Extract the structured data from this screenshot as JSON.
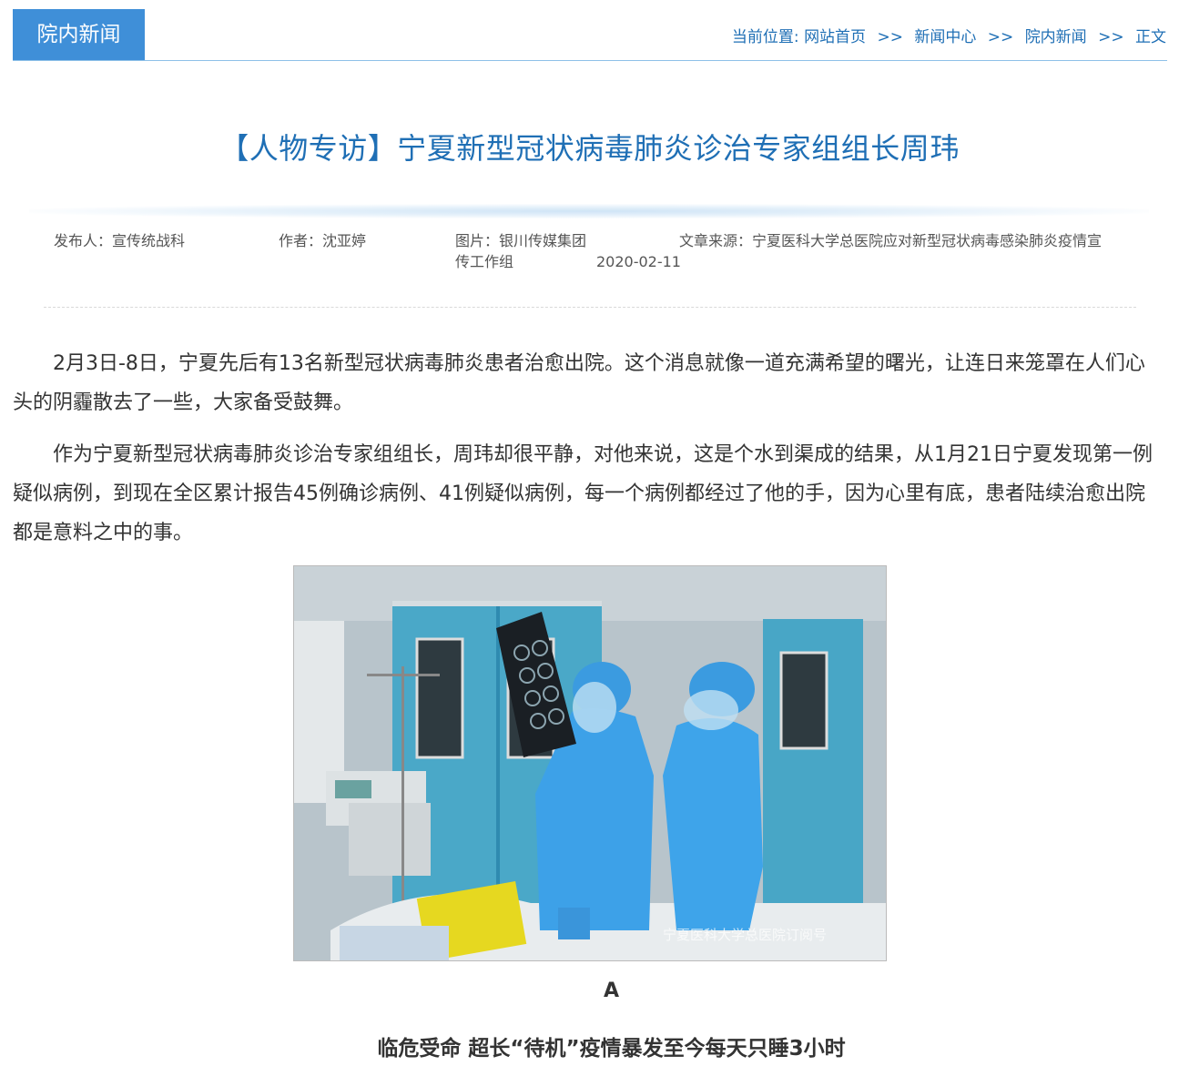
{
  "section_tab": "院内新闻",
  "breadcrumb": {
    "prefix": "当前位置:",
    "items": [
      "网站首页",
      "新闻中心",
      "院内新闻",
      "正文"
    ],
    "separator": ">>"
  },
  "article": {
    "title": "【人物专访】宁夏新型冠状病毒肺炎诊治专家组组长周玮",
    "meta": {
      "publisher": "发布人：宣传统战科",
      "author": "作者：沈亚婷",
      "photo_credit_line1": "图片：银川传媒集团",
      "photo_credit_line2": "传工作组",
      "date": "2020-02-11",
      "source": "文章来源：宁夏医科大学总医院应对新型冠状病毒感染肺炎疫情宣"
    },
    "paragraphs": [
      "2月3日-8日，宁夏先后有13名新型冠状病毒肺炎患者治愈出院。这个消息就像一道充满希望的曙光，让连日来笼罩在人们心头的阴霾散去了一些，大家备受鼓舞。",
      "作为宁夏新型冠状病毒肺炎诊治专家组组长，周玮却很平静，对他来说，这是个水到渠成的结果，从1月21日宁夏发现第一例疑似病例，到现在全区累计报告45例确诊病例、41例疑似病例，每一个病例都经过了他的手，因为心里有底，患者陆续治愈出院都是意料之中的事。"
    ],
    "photo_watermark": "宁夏医科大学总医院订阅号",
    "caption_letter": "A",
    "subheading": "临危受命 超长“待机”疫情暴发至今每天只睡3小时"
  },
  "colors": {
    "accent": "#3f8fd8",
    "link": "#1f6fb5",
    "text": "#333333"
  }
}
